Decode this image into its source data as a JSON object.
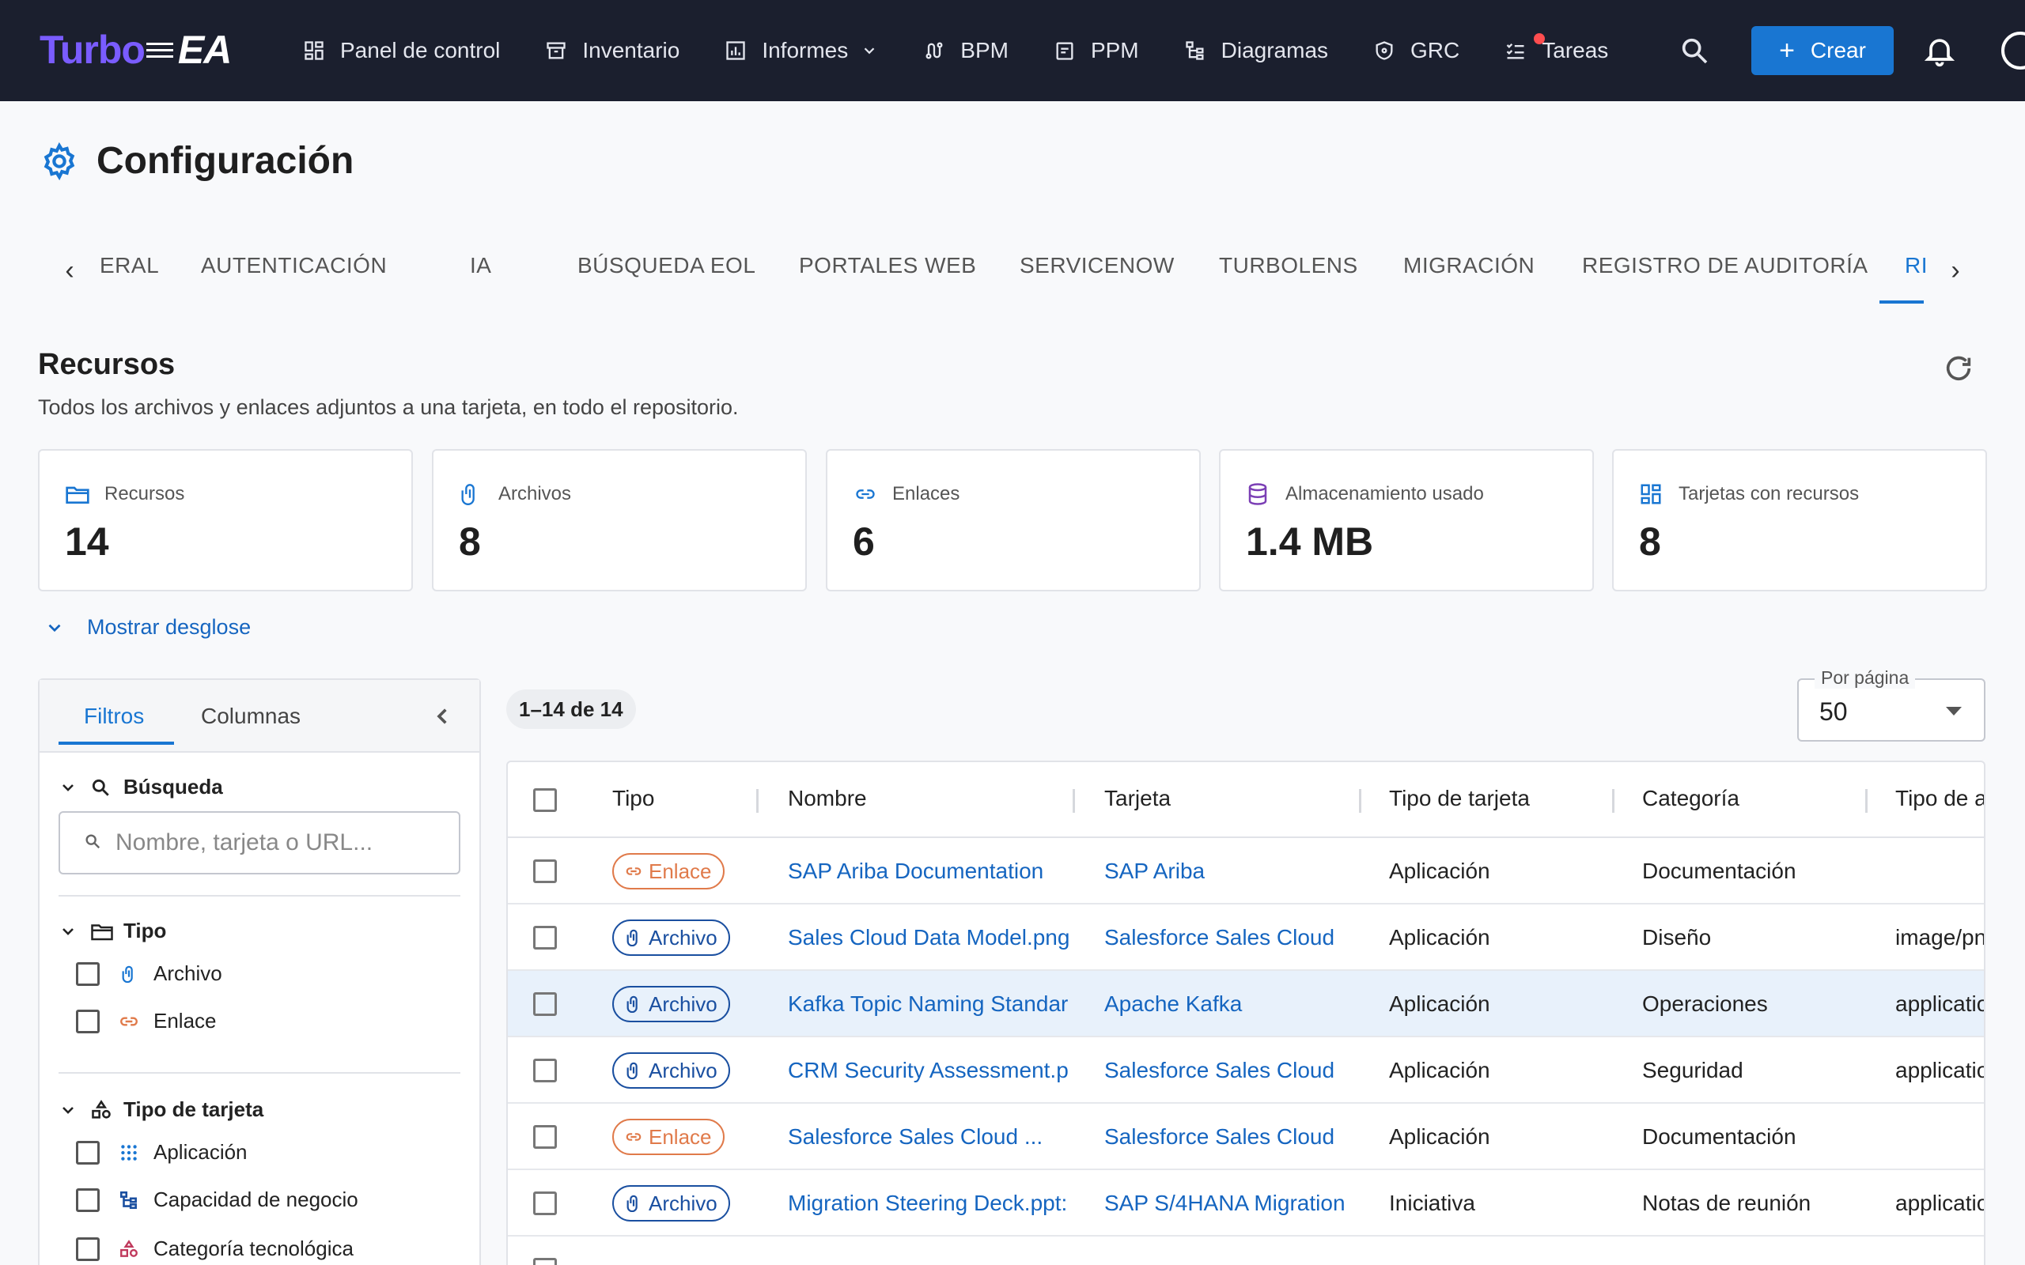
{
  "brand": {
    "part1": "Turbo",
    "part2": "EA"
  },
  "nav": {
    "items": [
      {
        "label": "Panel de control",
        "icon": "dashboard-icon"
      },
      {
        "label": "Inventario",
        "icon": "archive-icon"
      },
      {
        "label": "Informes",
        "icon": "chart-icon"
      },
      {
        "label": "BPM",
        "icon": "route-icon"
      },
      {
        "label": "PPM",
        "icon": "clipboard-icon"
      },
      {
        "label": "Diagramas",
        "icon": "hierarchy-icon"
      },
      {
        "label": "GRC",
        "icon": "shield-icon"
      },
      {
        "label": "Tareas",
        "icon": "checklist-icon"
      }
    ],
    "create_label": "Crear"
  },
  "page": {
    "title": "Configuración"
  },
  "tabs": [
    {
      "label": "ERAL"
    },
    {
      "label": "AUTENTICACIÓN"
    },
    {
      "label": "IA"
    },
    {
      "label": "BÚSQUEDA EOL"
    },
    {
      "label": "PORTALES WEB"
    },
    {
      "label": "SERVICENOW"
    },
    {
      "label": "TURBOLENS"
    },
    {
      "label": "MIGRACIÓN"
    },
    {
      "label": "REGISTRO DE AUDITORÍA"
    },
    {
      "label": "RI"
    }
  ],
  "resources": {
    "title": "Recursos",
    "subtitle": "Todos los archivos y enlaces adjuntos a una tarjeta, en todo el repositorio.",
    "stats": [
      {
        "label": "Recursos",
        "value": "14",
        "icon": "folder-icon",
        "color": "#1976d2"
      },
      {
        "label": "Archivos",
        "value": "8",
        "icon": "paperclip-icon",
        "color": "#1976d2"
      },
      {
        "label": "Enlaces",
        "value": "6",
        "icon": "link-icon",
        "color": "#1976d2"
      },
      {
        "label": "Almacenamiento usado",
        "value": "1.4 MB",
        "icon": "database-icon",
        "color": "#7b3fb5"
      },
      {
        "label": "Tarjetas con recursos",
        "value": "8",
        "icon": "grid-icon",
        "color": "#1976d2"
      }
    ],
    "breakdown_label": "Mostrar desglose"
  },
  "filters": {
    "tab_filters": "Filtros",
    "tab_columns": "Columnas",
    "search_section": "Búsqueda",
    "search_placeholder": "Nombre, tarjeta o URL...",
    "type_section": "Tipo",
    "type_options": [
      {
        "label": "Archivo",
        "icon": "paperclip-icon"
      },
      {
        "label": "Enlace",
        "icon": "link-icon"
      }
    ],
    "card_type_section": "Tipo de tarjeta",
    "card_type_options": [
      {
        "label": "Aplicación",
        "icon": "dots-grid-icon"
      },
      {
        "label": "Capacidad de negocio",
        "icon": "tree-icon"
      },
      {
        "label": "Categoría tecnológica",
        "icon": "shapes-icon"
      }
    ]
  },
  "table": {
    "count_label": "1–14 de 14",
    "per_page_label": "Por página",
    "per_page_value": "50",
    "columns": [
      "Tipo",
      "Nombre",
      "Tarjeta",
      "Tipo de tarjeta",
      "Categoría",
      "Tipo de a"
    ],
    "rows": [
      {
        "type": "Enlace",
        "name": "SAP Ariba Documentation",
        "card": "SAP Ariba",
        "card_type": "Aplicación",
        "category": "Documentación",
        "mime": ""
      },
      {
        "type": "Archivo",
        "name": "Sales Cloud Data Model.png",
        "card": "Salesforce Sales Cloud",
        "card_type": "Aplicación",
        "category": "Diseño",
        "mime": "image/pn"
      },
      {
        "type": "Archivo",
        "name": "Kafka Topic Naming Standar",
        "card": "Apache Kafka",
        "card_type": "Aplicación",
        "category": "Operaciones",
        "mime": "applicatio"
      },
      {
        "type": "Archivo",
        "name": "CRM Security Assessment.p",
        "card": "Salesforce Sales Cloud",
        "card_type": "Aplicación",
        "category": "Seguridad",
        "mime": "applicatio"
      },
      {
        "type": "Enlace",
        "name": "Salesforce Sales Cloud ...",
        "card": "Salesforce Sales Cloud",
        "card_type": "Aplicación",
        "category": "Documentación",
        "mime": ""
      },
      {
        "type": "Archivo",
        "name": "Migration Steering Deck.ppt:",
        "card": "SAP S/4HANA Migration",
        "card_type": "Iniciativa",
        "category": "Notas de reunión",
        "mime": "applicatio"
      }
    ]
  }
}
